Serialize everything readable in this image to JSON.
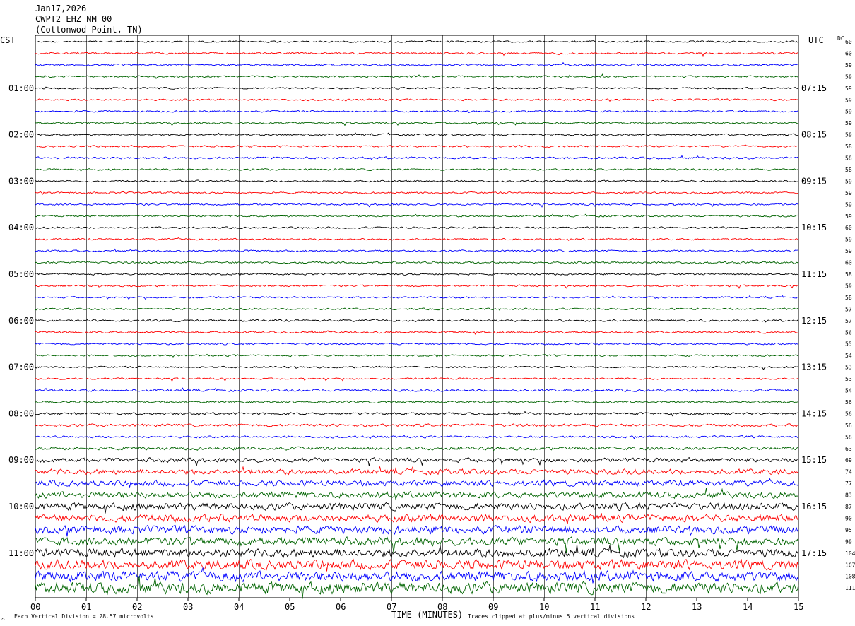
{
  "header": {
    "date": "Jan17,2026",
    "station": "CWPT2 EHZ NM 00",
    "location": "(Cottonwod Point, TN)"
  },
  "left_tz": "CST",
  "right_tz": "UTC",
  "dc_label": "DC",
  "footer": {
    "scale_note": "Each Vertical Division =   28.57 microvolts",
    "clip_note": "Traces clipped at plus/minus 5 vertical divisions",
    "corner_mark": "^"
  },
  "chart_data": {
    "type": "line",
    "xlabel": "TIME (MINUTES)",
    "x_ticks": [
      "00",
      "01",
      "02",
      "03",
      "04",
      "05",
      "06",
      "07",
      "08",
      "09",
      "10",
      "11",
      "12",
      "13",
      "14",
      "15"
    ],
    "xlim": [
      0,
      15
    ],
    "row_count": 48,
    "row_interval_minutes": 15,
    "colors": [
      "#000000",
      "#ff0000",
      "#0000ff",
      "#006400"
    ],
    "left_hour_labels": [
      "01:00",
      "02:00",
      "03:00",
      "04:00",
      "05:00",
      "06:00",
      "07:00",
      "08:00",
      "09:00",
      "10:00",
      "11:00"
    ],
    "right_hour_labels": [
      "07:15",
      "08:15",
      "09:15",
      "10:15",
      "11:15",
      "12:15",
      "13:15",
      "14:15",
      "15:15",
      "16:15",
      "17:15"
    ],
    "dc_offsets": [
      60,
      60,
      59,
      59,
      59,
      59,
      59,
      59,
      59,
      58,
      58,
      58,
      59,
      59,
      59,
      59,
      60,
      59,
      59,
      60,
      58,
      59,
      58,
      57,
      57,
      56,
      55,
      54,
      53,
      53,
      54,
      56,
      56,
      56,
      58,
      63,
      69,
      74,
      77,
      83,
      87,
      90,
      95,
      99,
      104,
      107,
      108,
      111
    ],
    "noise_amplitude": [
      1,
      1,
      1,
      1,
      1,
      1,
      1,
      1,
      1,
      1,
      1.2,
      1,
      1,
      1,
      1,
      1,
      1,
      1,
      1,
      1.1,
      1,
      1,
      1,
      1,
      1.2,
      1.1,
      1,
      1,
      1,
      1,
      1.3,
      1.1,
      1.3,
      1.5,
      1.2,
      1.8,
      2.5,
      3,
      3.2,
      3.6,
      4,
      4.2,
      4.4,
      4.6,
      4.8,
      5.4,
      5.8,
      6.4
    ]
  }
}
